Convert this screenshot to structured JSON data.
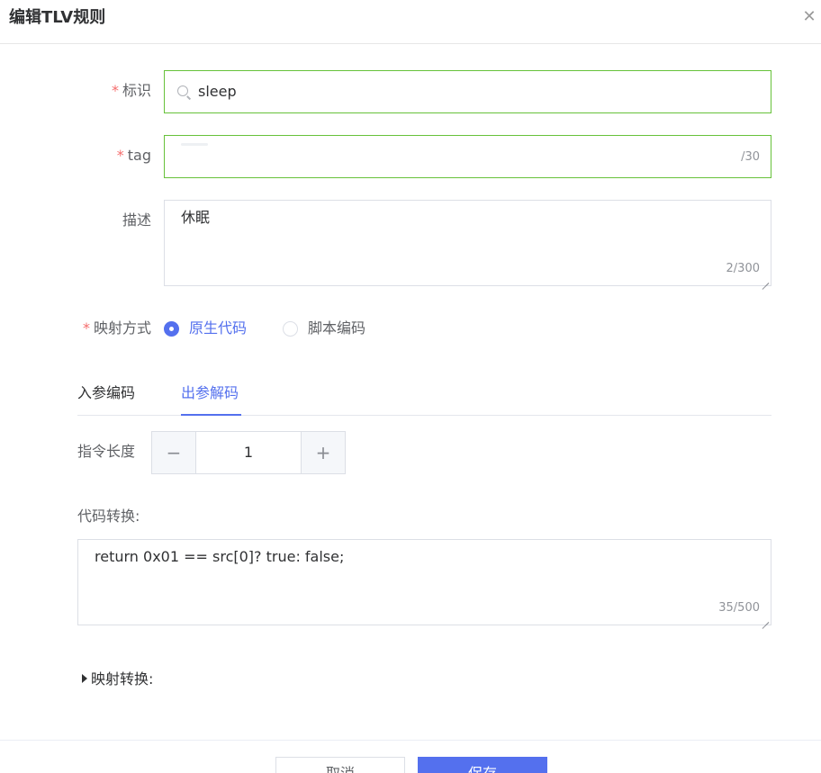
{
  "dialog": {
    "title": "编辑TLV规则",
    "close_icon": "close-icon"
  },
  "form": {
    "identifier": {
      "required_mark": "*",
      "label": "标识",
      "value": "sleep",
      "icon": "search-icon"
    },
    "tag": {
      "required_mark": "*",
      "label": "tag",
      "value": "",
      "counter": "/30"
    },
    "description": {
      "label": "描述",
      "value": "休眠",
      "counter": "2/300"
    },
    "mapping_mode": {
      "required_mark": "*",
      "label": "映射方式",
      "options": [
        {
          "label": "原生代码",
          "selected": true
        },
        {
          "label": "脚本编码",
          "selected": false
        }
      ]
    },
    "tabs": [
      {
        "label": "入参编码",
        "active": false
      },
      {
        "label": "出参解码",
        "active": true
      }
    ],
    "command_length": {
      "label": "指令长度",
      "minus": "−",
      "plus": "+",
      "value": "1"
    },
    "code_conversion": {
      "label": "代码转换:",
      "value": "return 0x01 == src[0]? true: false;",
      "counter": "35/500"
    },
    "mapping_conversion": {
      "label": "映射转换:",
      "icon": "caret-right-icon"
    }
  },
  "footer": {
    "cancel_label": "取消",
    "save_label": "保存"
  },
  "colors": {
    "accent": "#5470ee",
    "valid_border": "#67c23a",
    "required": "#f56c6c"
  }
}
